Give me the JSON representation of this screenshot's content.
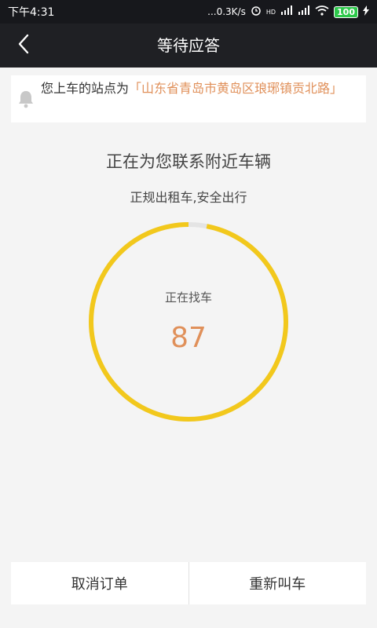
{
  "status_bar": {
    "time": "下午4:31",
    "network_speed": "...0.3K/s",
    "network_type": "HD",
    "battery": "100"
  },
  "nav": {
    "back_icon": "chevron-left-icon",
    "title": "等待应答"
  },
  "notice": {
    "icon": "bell-icon",
    "prefix": "您上车的站点为",
    "address": "「山东省青岛市黄岛区琅琊镇贡北路」"
  },
  "main": {
    "headline": "正在为您联系附近车辆",
    "subline": "正规出租车,安全出行"
  },
  "progress": {
    "label": "正在找车",
    "count": "87",
    "fraction_complete": 0.97,
    "ring_color": "#f2c81c",
    "track_color": "#e4e4e4"
  },
  "actions": {
    "cancel_label": "取消订单",
    "recall_label": "重新叫车"
  }
}
